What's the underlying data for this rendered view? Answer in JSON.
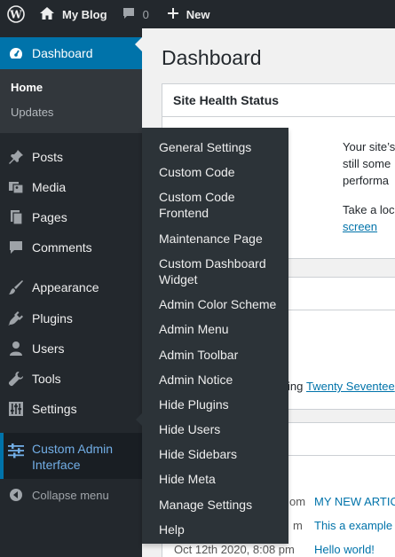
{
  "adminbar": {
    "site_name": "My Blog",
    "comments_count": "0",
    "new_label": "New"
  },
  "sidebar": {
    "dashboard": "Dashboard",
    "submenu": {
      "home": "Home",
      "updates": "Updates"
    },
    "items": [
      {
        "label": "Posts",
        "icon": "pin-icon"
      },
      {
        "label": "Media",
        "icon": "media-icon"
      },
      {
        "label": "Pages",
        "icon": "pages-icon"
      },
      {
        "label": "Comments",
        "icon": "comment-icon"
      },
      {
        "label": "Appearance",
        "icon": "brush-icon"
      },
      {
        "label": "Plugins",
        "icon": "plugin-icon"
      },
      {
        "label": "Users",
        "icon": "user-icon"
      },
      {
        "label": "Tools",
        "icon": "wrench-icon"
      },
      {
        "label": "Settings",
        "icon": "settings-icon"
      }
    ],
    "custom_admin": "Custom Admin Interface",
    "collapse": "Collapse menu"
  },
  "flyout": [
    "General Settings",
    "Custom Code",
    "Custom Code Frontend",
    "Maintenance Page",
    "Custom Dashboard Widget",
    "Admin Color Scheme",
    "Admin Menu",
    "Admin Toolbar",
    "Admin Notice",
    "Hide Plugins",
    "Hide Users",
    "Hide Sidebars",
    "Hide Meta",
    "Manage Settings",
    "Help"
  ],
  "main": {
    "title": "Dashboard",
    "site_health": {
      "title": "Site Health Status",
      "lines": [
        "Your site’s",
        "still some",
        "performa"
      ],
      "take": "Take a loc",
      "screen_link": "screen"
    },
    "theme_text": "ing",
    "theme_link": "Twenty Seventee",
    "activity": [
      {
        "date": "om",
        "title": "MY NEW ARTIC"
      },
      {
        "date": "m",
        "title": "This a example"
      },
      {
        "date": "Oct 12th 2020, 8:08 pm",
        "title": "Hello world!"
      }
    ]
  }
}
